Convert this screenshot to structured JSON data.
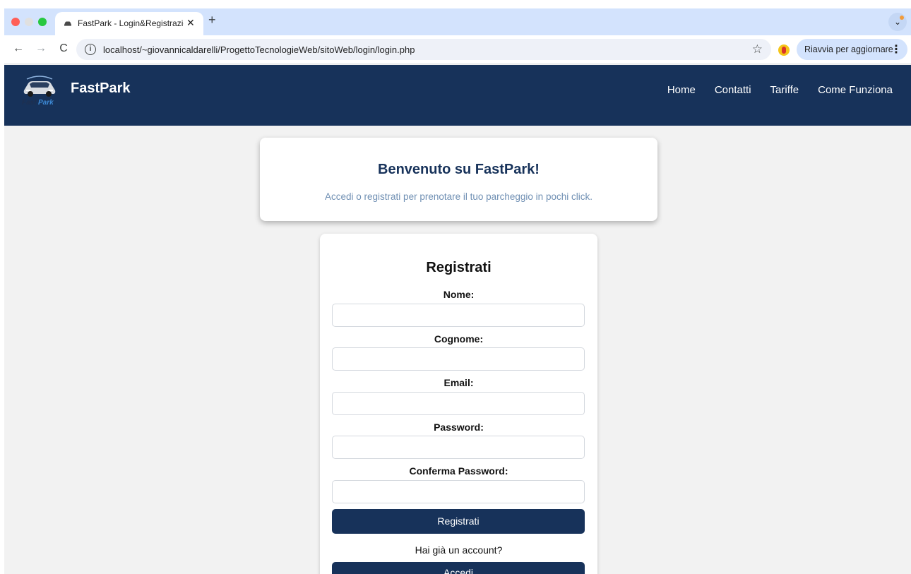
{
  "browser": {
    "tab_title": "FastPark - Login&Registrazione",
    "tab_close": "✕",
    "new_tab": "+",
    "tabs_menu": "⌄",
    "url": "localhost/~giovannicaldarelli/ProgettoTecnologieWeb/sitoWeb/login/login.php",
    "back": "←",
    "forward": "→",
    "reload": "C",
    "site_info": "i",
    "bookmark": "☆",
    "update_label": "Riavvia per aggiornare",
    "kebab": "⋮"
  },
  "header": {
    "brand": "FastPark",
    "nav": [
      "Home",
      "Contatti",
      "Tariffe",
      "Come Funziona"
    ]
  },
  "welcome": {
    "title": "Benvenuto su FastPark!",
    "subtitle": "Accedi o registrati per prenotare il tuo parcheggio in pochi click."
  },
  "register_form": {
    "title": "Registrati",
    "fields": [
      {
        "label": "Nome:",
        "value": ""
      },
      {
        "label": "Cognome:",
        "value": ""
      },
      {
        "label": "Email:",
        "value": ""
      },
      {
        "label": "Password:",
        "value": ""
      },
      {
        "label": "Conferma Password:",
        "value": ""
      }
    ],
    "submit_label": "Registrati",
    "have_account": "Hai già un account?",
    "login_label": "Accedi"
  },
  "colors": {
    "header_bg": "#17325a",
    "page_bg": "#f2f2f2",
    "welcome_subtitle": "#6f8fb3",
    "button_bg": "#17325a"
  }
}
